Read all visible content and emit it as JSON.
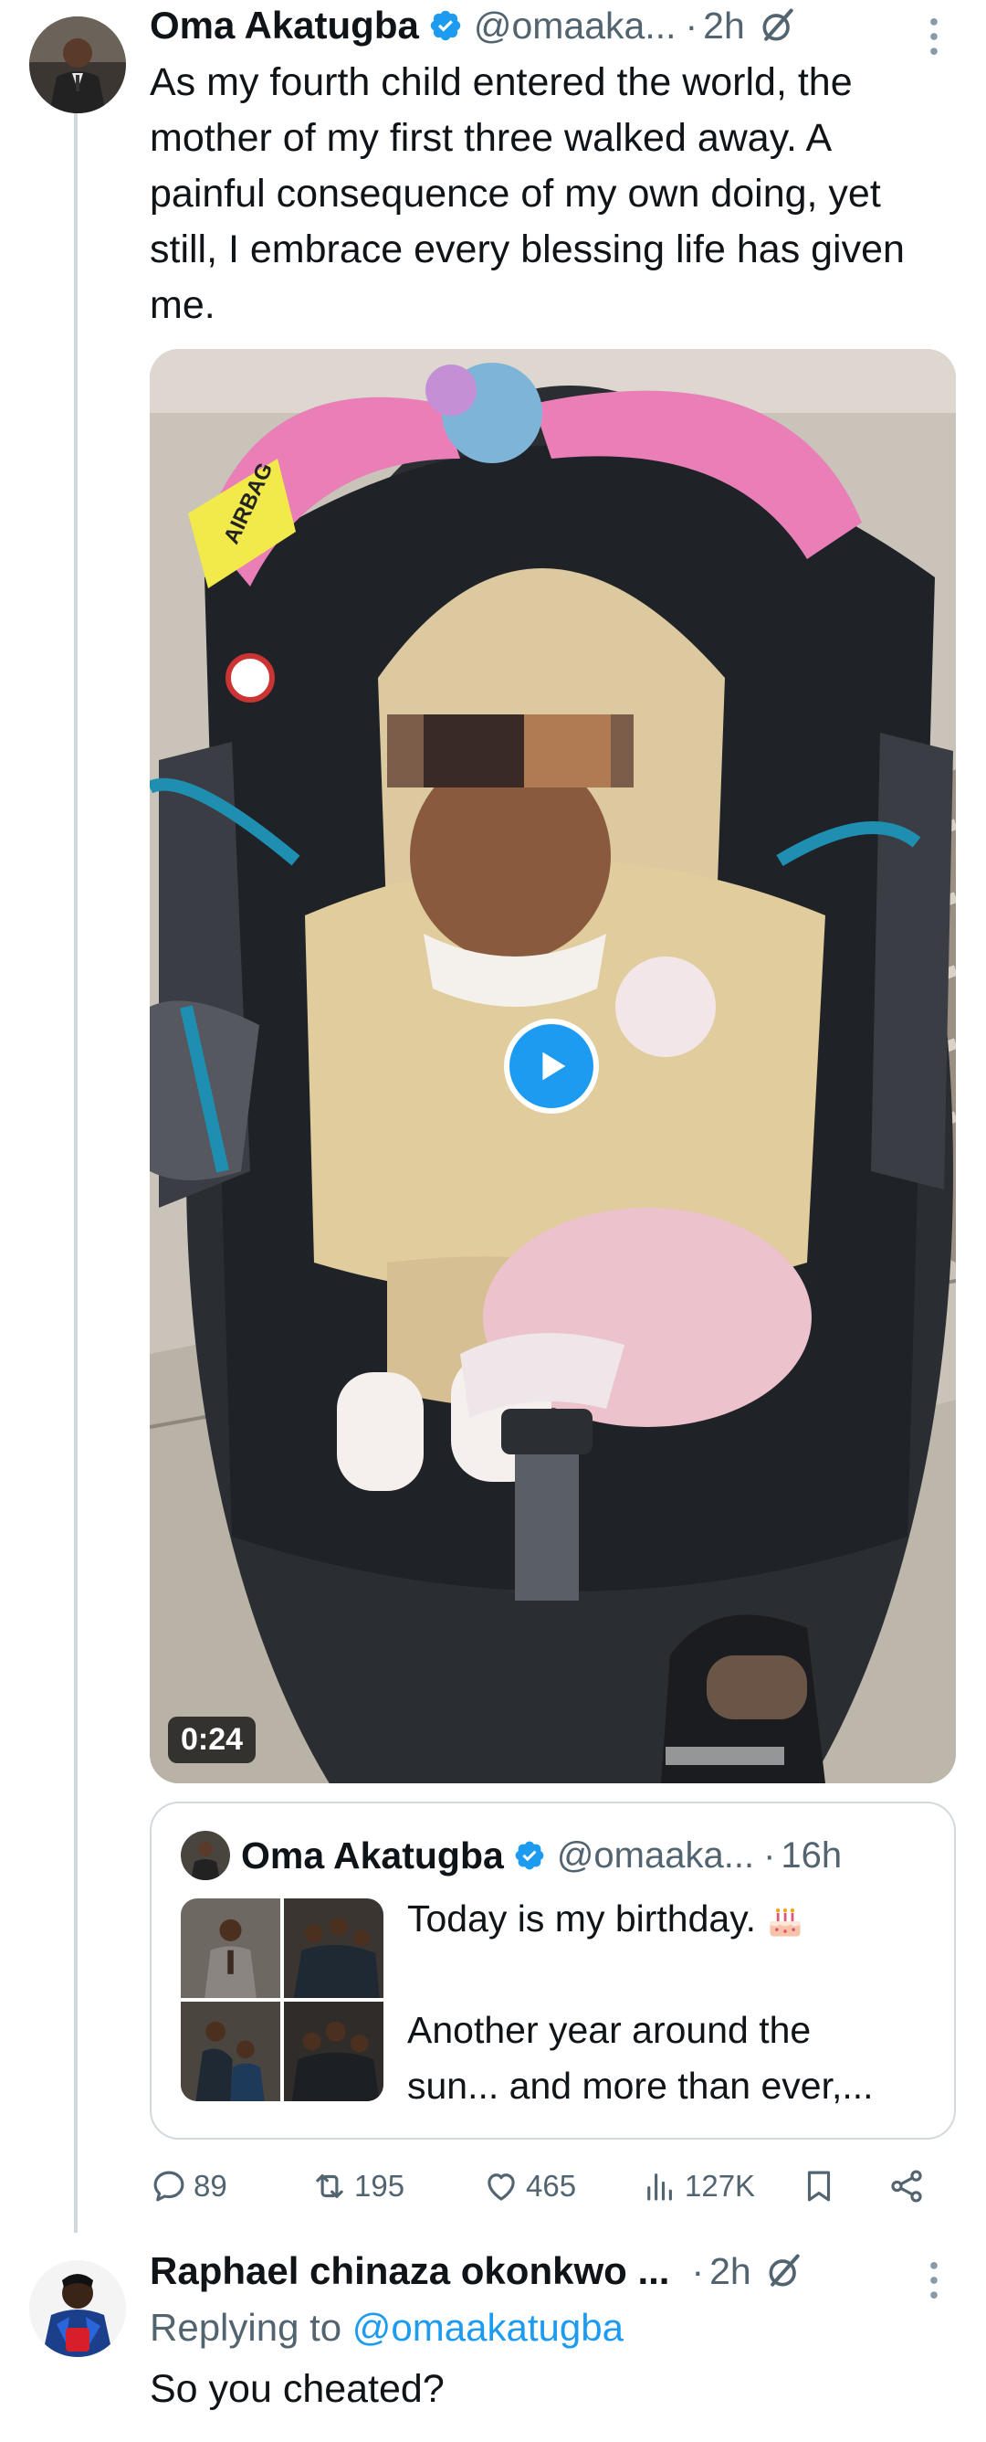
{
  "main_tweet": {
    "author_name": "Oma Akatugba",
    "handle": "@omaaka...",
    "separator": "·",
    "time": "2h",
    "text": "As my fourth child entered the world, the mother of my first three walked away. A painful consequence of my own doing, yet still, I embrace every blessing life has given me.",
    "video_duration": "0:24",
    "media_labels": {
      "car_seat_tag": "AIRBAG"
    }
  },
  "quoted_tweet": {
    "author_name": "Oma Akatugba",
    "handle": "@omaaka...",
    "separator": "·",
    "time": "16h",
    "line1": "Today is my birthday.",
    "line2": "Another year around the",
    "line3": "sun... and more than ever,..."
  },
  "actions": {
    "replies": "89",
    "reposts": "195",
    "likes": "465",
    "views": "127K"
  },
  "reply": {
    "author_name": "Raphael chinaza okonkwo ...",
    "separator": "·",
    "time": "2h",
    "replying_prefix": "Replying to",
    "replying_to": "@omaakatugba",
    "text": "So you cheated?"
  },
  "icons": {
    "verified": "verified-badge-icon",
    "edited": "edit-slash-icon",
    "more": "more-vertical-icon",
    "reply": "reply-bubble-icon",
    "repost": "repost-icon",
    "like": "heart-icon",
    "views": "views-bar-icon",
    "bookmark": "bookmark-icon",
    "share": "share-icon",
    "play": "play-icon",
    "cake": "birthday-cake-icon"
  },
  "colors": {
    "accent": "#1d9bf0",
    "text_primary": "#0f1419",
    "text_secondary": "#536471",
    "border": "#cfd9de"
  }
}
